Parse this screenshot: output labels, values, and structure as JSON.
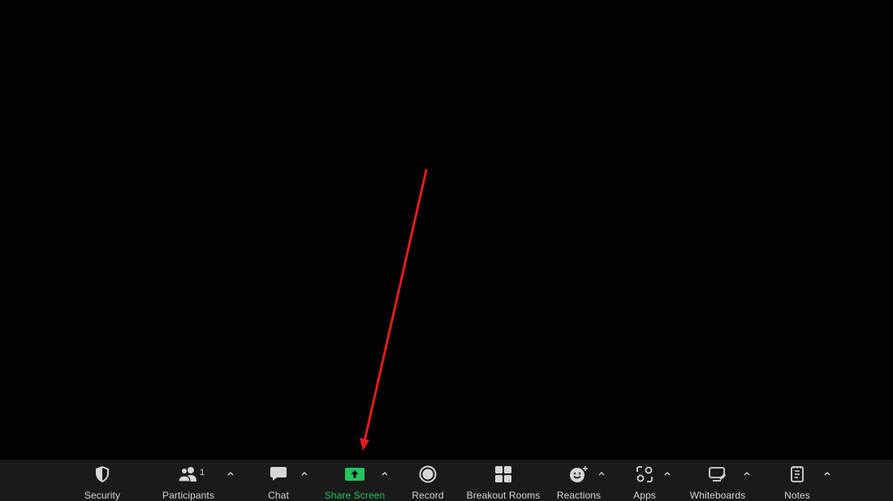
{
  "toolbar": {
    "buttons": [
      {
        "id": "security",
        "label": "Security",
        "icon": "shield-icon"
      },
      {
        "id": "participants",
        "label": "Participants",
        "icon": "people-icon",
        "count": "1"
      },
      {
        "id": "chat",
        "label": "Chat",
        "icon": "chat-bubble-icon"
      },
      {
        "id": "share-screen",
        "label": "Share Screen",
        "icon": "share-screen-icon"
      },
      {
        "id": "record",
        "label": "Record",
        "icon": "record-icon"
      },
      {
        "id": "breakout-rooms",
        "label": "Breakout Rooms",
        "icon": "grid-icon"
      },
      {
        "id": "reactions",
        "label": "Reactions",
        "icon": "smiley-plus-icon"
      },
      {
        "id": "apps",
        "label": "Apps",
        "icon": "apps-icon"
      },
      {
        "id": "whiteboards",
        "label": "Whiteboards",
        "icon": "whiteboard-icon"
      },
      {
        "id": "notes",
        "label": "Notes",
        "icon": "notes-icon"
      }
    ],
    "caret_glyph": "^"
  },
  "colors": {
    "background": "#020202",
    "toolbar_bg": "#1a1a1a",
    "label": "#d6d6d6",
    "share_green": "#22c55e",
    "annotation_red": "#e11d1d"
  }
}
